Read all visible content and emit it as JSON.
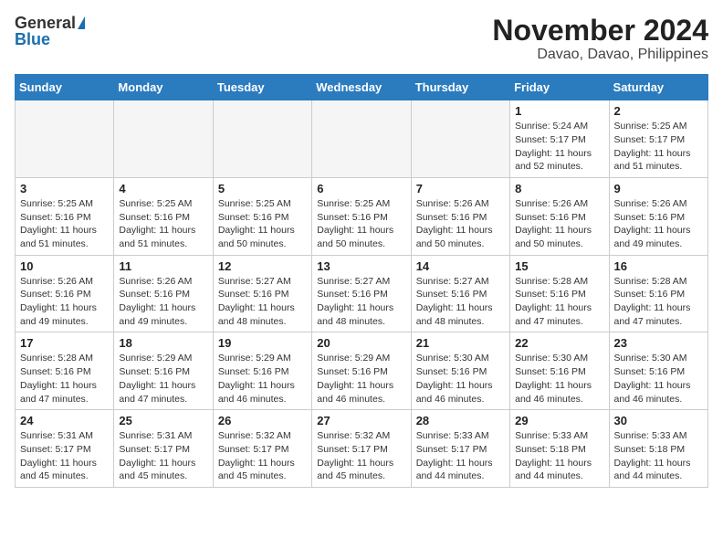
{
  "header": {
    "logo_general": "General",
    "logo_blue": "Blue",
    "title": "November 2024",
    "subtitle": "Davao, Davao, Philippines"
  },
  "calendar": {
    "days_of_week": [
      "Sunday",
      "Monday",
      "Tuesday",
      "Wednesday",
      "Thursday",
      "Friday",
      "Saturday"
    ],
    "weeks": [
      [
        {
          "day": "",
          "info": ""
        },
        {
          "day": "",
          "info": ""
        },
        {
          "day": "",
          "info": ""
        },
        {
          "day": "",
          "info": ""
        },
        {
          "day": "",
          "info": ""
        },
        {
          "day": "1",
          "info": "Sunrise: 5:24 AM\nSunset: 5:17 PM\nDaylight: 11 hours\nand 52 minutes."
        },
        {
          "day": "2",
          "info": "Sunrise: 5:25 AM\nSunset: 5:17 PM\nDaylight: 11 hours\nand 51 minutes."
        }
      ],
      [
        {
          "day": "3",
          "info": "Sunrise: 5:25 AM\nSunset: 5:16 PM\nDaylight: 11 hours\nand 51 minutes."
        },
        {
          "day": "4",
          "info": "Sunrise: 5:25 AM\nSunset: 5:16 PM\nDaylight: 11 hours\nand 51 minutes."
        },
        {
          "day": "5",
          "info": "Sunrise: 5:25 AM\nSunset: 5:16 PM\nDaylight: 11 hours\nand 50 minutes."
        },
        {
          "day": "6",
          "info": "Sunrise: 5:25 AM\nSunset: 5:16 PM\nDaylight: 11 hours\nand 50 minutes."
        },
        {
          "day": "7",
          "info": "Sunrise: 5:26 AM\nSunset: 5:16 PM\nDaylight: 11 hours\nand 50 minutes."
        },
        {
          "day": "8",
          "info": "Sunrise: 5:26 AM\nSunset: 5:16 PM\nDaylight: 11 hours\nand 50 minutes."
        },
        {
          "day": "9",
          "info": "Sunrise: 5:26 AM\nSunset: 5:16 PM\nDaylight: 11 hours\nand 49 minutes."
        }
      ],
      [
        {
          "day": "10",
          "info": "Sunrise: 5:26 AM\nSunset: 5:16 PM\nDaylight: 11 hours\nand 49 minutes."
        },
        {
          "day": "11",
          "info": "Sunrise: 5:26 AM\nSunset: 5:16 PM\nDaylight: 11 hours\nand 49 minutes."
        },
        {
          "day": "12",
          "info": "Sunrise: 5:27 AM\nSunset: 5:16 PM\nDaylight: 11 hours\nand 48 minutes."
        },
        {
          "day": "13",
          "info": "Sunrise: 5:27 AM\nSunset: 5:16 PM\nDaylight: 11 hours\nand 48 minutes."
        },
        {
          "day": "14",
          "info": "Sunrise: 5:27 AM\nSunset: 5:16 PM\nDaylight: 11 hours\nand 48 minutes."
        },
        {
          "day": "15",
          "info": "Sunrise: 5:28 AM\nSunset: 5:16 PM\nDaylight: 11 hours\nand 47 minutes."
        },
        {
          "day": "16",
          "info": "Sunrise: 5:28 AM\nSunset: 5:16 PM\nDaylight: 11 hours\nand 47 minutes."
        }
      ],
      [
        {
          "day": "17",
          "info": "Sunrise: 5:28 AM\nSunset: 5:16 PM\nDaylight: 11 hours\nand 47 minutes."
        },
        {
          "day": "18",
          "info": "Sunrise: 5:29 AM\nSunset: 5:16 PM\nDaylight: 11 hours\nand 47 minutes."
        },
        {
          "day": "19",
          "info": "Sunrise: 5:29 AM\nSunset: 5:16 PM\nDaylight: 11 hours\nand 46 minutes."
        },
        {
          "day": "20",
          "info": "Sunrise: 5:29 AM\nSunset: 5:16 PM\nDaylight: 11 hours\nand 46 minutes."
        },
        {
          "day": "21",
          "info": "Sunrise: 5:30 AM\nSunset: 5:16 PM\nDaylight: 11 hours\nand 46 minutes."
        },
        {
          "day": "22",
          "info": "Sunrise: 5:30 AM\nSunset: 5:16 PM\nDaylight: 11 hours\nand 46 minutes."
        },
        {
          "day": "23",
          "info": "Sunrise: 5:30 AM\nSunset: 5:16 PM\nDaylight: 11 hours\nand 46 minutes."
        }
      ],
      [
        {
          "day": "24",
          "info": "Sunrise: 5:31 AM\nSunset: 5:17 PM\nDaylight: 11 hours\nand 45 minutes."
        },
        {
          "day": "25",
          "info": "Sunrise: 5:31 AM\nSunset: 5:17 PM\nDaylight: 11 hours\nand 45 minutes."
        },
        {
          "day": "26",
          "info": "Sunrise: 5:32 AM\nSunset: 5:17 PM\nDaylight: 11 hours\nand 45 minutes."
        },
        {
          "day": "27",
          "info": "Sunrise: 5:32 AM\nSunset: 5:17 PM\nDaylight: 11 hours\nand 45 minutes."
        },
        {
          "day": "28",
          "info": "Sunrise: 5:33 AM\nSunset: 5:17 PM\nDaylight: 11 hours\nand 44 minutes."
        },
        {
          "day": "29",
          "info": "Sunrise: 5:33 AM\nSunset: 5:18 PM\nDaylight: 11 hours\nand 44 minutes."
        },
        {
          "day": "30",
          "info": "Sunrise: 5:33 AM\nSunset: 5:18 PM\nDaylight: 11 hours\nand 44 minutes."
        }
      ]
    ]
  }
}
